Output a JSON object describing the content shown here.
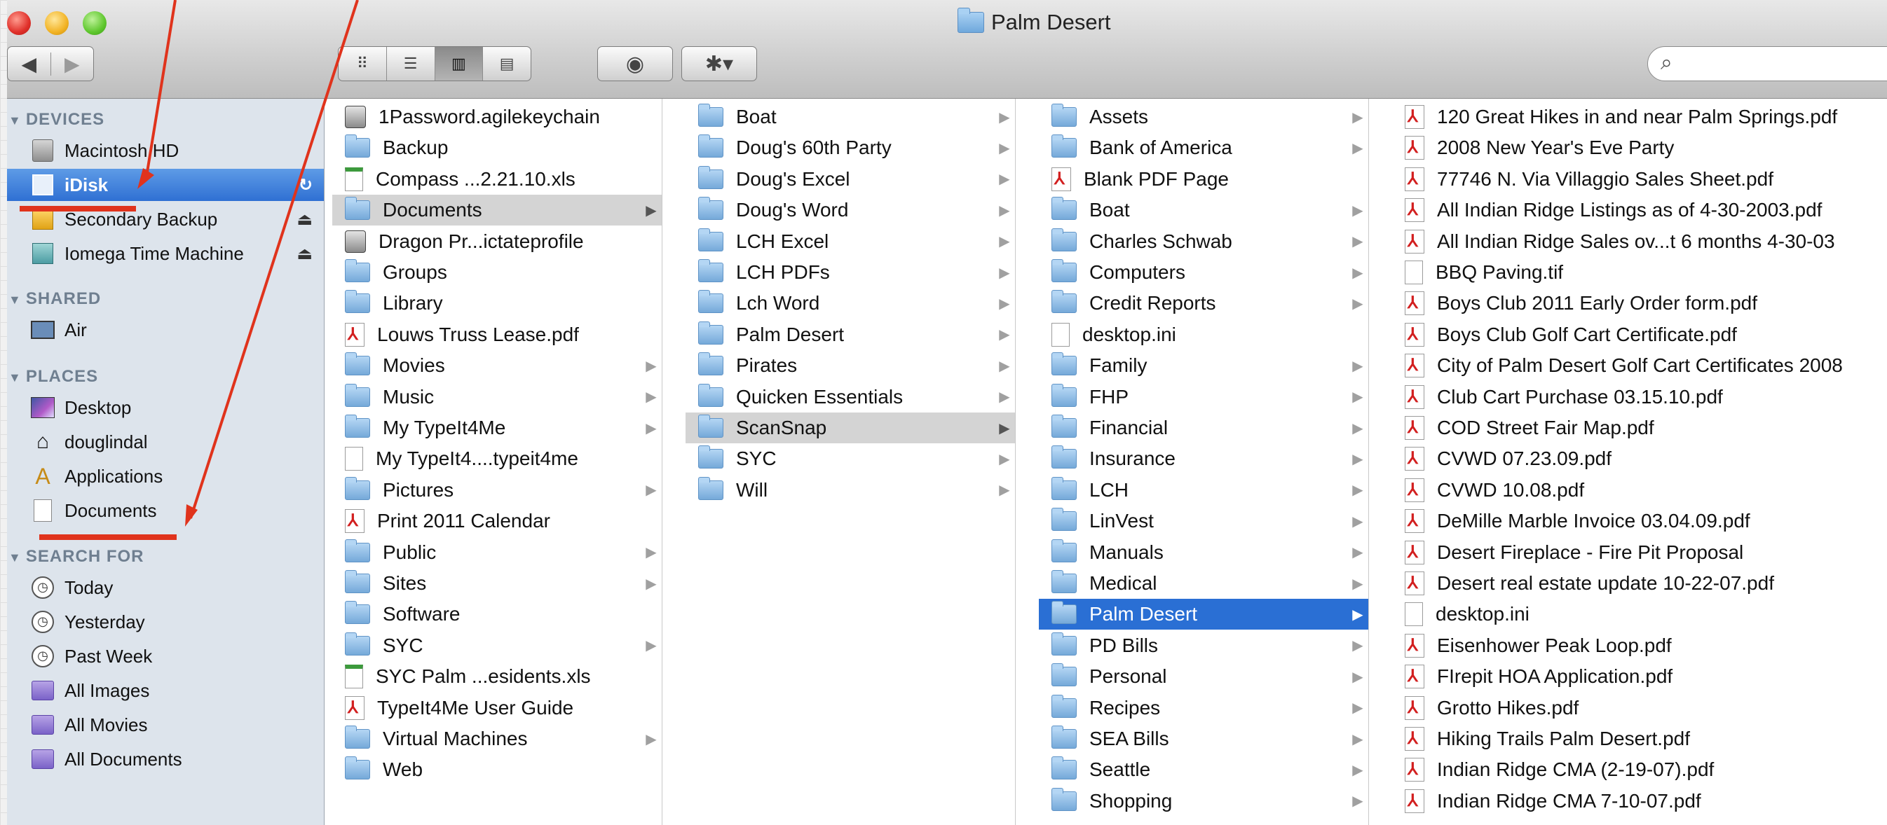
{
  "window": {
    "title": "Palm Desert"
  },
  "toolbar": {
    "back_icon": "◀",
    "forward_icon": "▶",
    "view_icons": [
      "icon-view-icon",
      "list-view-icon",
      "column-view-icon",
      "coverflow-view-icon"
    ],
    "view_glyphs": [
      "⠿",
      "☰",
      "▥",
      "▤"
    ],
    "quicklook_glyph": "◉",
    "action_glyph": "✱▾",
    "search_glyph": "⌕",
    "search_value": ""
  },
  "sidebar": {
    "devices_header": "DEVICES",
    "devices": [
      {
        "label": "Macintosh HD",
        "icon": "hard-disk-icon"
      },
      {
        "label": "iDisk",
        "icon": "idisk-icon",
        "selected": true,
        "badge": "↻"
      },
      {
        "label": "Secondary Backup",
        "icon": "external-disk-icon",
        "eject": "⏏"
      },
      {
        "label": "Iomega Time Machine",
        "icon": "time-machine-disk-icon",
        "eject": "⏏"
      }
    ],
    "shared_header": "SHARED",
    "shared": [
      {
        "label": "Air",
        "icon": "monitor-icon"
      }
    ],
    "places_header": "PLACES",
    "places": [
      {
        "label": "Desktop",
        "icon": "desktop-icon"
      },
      {
        "label": "douglindal",
        "icon": "home-icon"
      },
      {
        "label": "Applications",
        "icon": "applications-icon"
      },
      {
        "label": "Documents",
        "icon": "documents-icon"
      }
    ],
    "search_header": "SEARCH FOR",
    "search_for": [
      {
        "label": "Today",
        "icon": "clock-icon"
      },
      {
        "label": "Yesterday",
        "icon": "clock-icon"
      },
      {
        "label": "Past Week",
        "icon": "clock-icon"
      },
      {
        "label": "All Images",
        "icon": "smart-folder-icon"
      },
      {
        "label": "All Movies",
        "icon": "smart-folder-icon"
      },
      {
        "label": "All Documents",
        "icon": "smart-folder-icon"
      }
    ]
  },
  "columns": [
    {
      "items": [
        {
          "label": "1Password.agilekeychain",
          "type": "app"
        },
        {
          "label": "Backup",
          "type": "folder"
        },
        {
          "label": "Compass ...2.21.10.xls",
          "type": "xls"
        },
        {
          "label": "Documents",
          "type": "folder",
          "arrow": true,
          "selected": "gray"
        },
        {
          "label": "Dragon Pr...ictateprofile",
          "type": "app"
        },
        {
          "label": "Groups",
          "type": "folder"
        },
        {
          "label": "Library",
          "type": "folder"
        },
        {
          "label": "Louws Truss Lease.pdf",
          "type": "pdf"
        },
        {
          "label": "Movies",
          "type": "folder",
          "arrow": true
        },
        {
          "label": "Music",
          "type": "folder",
          "arrow": true
        },
        {
          "label": "My TypeIt4Me",
          "type": "folder",
          "arrow": true
        },
        {
          "label": "My TypeIt4....typeit4me",
          "type": "doc"
        },
        {
          "label": "Pictures",
          "type": "folder",
          "arrow": true
        },
        {
          "label": "Print 2011 Calendar",
          "type": "pdf"
        },
        {
          "label": "Public",
          "type": "folder",
          "arrow": true
        },
        {
          "label": "Sites",
          "type": "folder",
          "arrow": true
        },
        {
          "label": "Software",
          "type": "folder"
        },
        {
          "label": "SYC",
          "type": "folder",
          "arrow": true
        },
        {
          "label": "SYC Palm ...esidents.xls",
          "type": "xls"
        },
        {
          "label": "TypeIt4Me User Guide",
          "type": "pdf"
        },
        {
          "label": "Virtual Machines",
          "type": "folder",
          "arrow": true
        },
        {
          "label": "Web",
          "type": "folder"
        }
      ]
    },
    {
      "items": [
        {
          "label": "Boat",
          "type": "folder",
          "arrow": true
        },
        {
          "label": "Doug's 60th Party",
          "type": "folder",
          "arrow": true
        },
        {
          "label": "Doug's Excel",
          "type": "folder",
          "arrow": true
        },
        {
          "label": "Doug's Word",
          "type": "folder",
          "arrow": true
        },
        {
          "label": "LCH Excel",
          "type": "folder",
          "arrow": true
        },
        {
          "label": "LCH PDFs",
          "type": "folder",
          "arrow": true
        },
        {
          "label": "Lch Word",
          "type": "folder",
          "arrow": true
        },
        {
          "label": "Palm Desert",
          "type": "folder",
          "arrow": true
        },
        {
          "label": "Pirates",
          "type": "folder",
          "arrow": true
        },
        {
          "label": "Quicken Essentials",
          "type": "folder",
          "arrow": true
        },
        {
          "label": "ScanSnap",
          "type": "folder",
          "arrow": true,
          "selected": "gray"
        },
        {
          "label": "SYC",
          "type": "folder",
          "arrow": true
        },
        {
          "label": "Will",
          "type": "folder",
          "arrow": true
        }
      ]
    },
    {
      "items": [
        {
          "label": "Assets",
          "type": "folder",
          "arrow": true
        },
        {
          "label": "Bank of America",
          "type": "folder",
          "arrow": true
        },
        {
          "label": "Blank PDF Page",
          "type": "pdf"
        },
        {
          "label": "Boat",
          "type": "folder",
          "arrow": true
        },
        {
          "label": "Charles Schwab",
          "type": "folder",
          "arrow": true
        },
        {
          "label": "Computers",
          "type": "folder",
          "arrow": true
        },
        {
          "label": "Credit Reports",
          "type": "folder",
          "arrow": true
        },
        {
          "label": "desktop.ini",
          "type": "doc"
        },
        {
          "label": "Family",
          "type": "folder",
          "arrow": true
        },
        {
          "label": "FHP",
          "type": "folder",
          "arrow": true
        },
        {
          "label": "Financial",
          "type": "folder",
          "arrow": true
        },
        {
          "label": "Insurance",
          "type": "folder",
          "arrow": true
        },
        {
          "label": "LCH",
          "type": "folder",
          "arrow": true
        },
        {
          "label": "LinVest",
          "type": "folder",
          "arrow": true
        },
        {
          "label": "Manuals",
          "type": "folder",
          "arrow": true
        },
        {
          "label": "Medical",
          "type": "folder",
          "arrow": true
        },
        {
          "label": "Palm Desert",
          "type": "folder",
          "arrow": true,
          "selected": "blue"
        },
        {
          "label": "PD Bills",
          "type": "folder",
          "arrow": true
        },
        {
          "label": "Personal",
          "type": "folder",
          "arrow": true
        },
        {
          "label": "Recipes",
          "type": "folder",
          "arrow": true
        },
        {
          "label": "SEA Bills",
          "type": "folder",
          "arrow": true
        },
        {
          "label": "Seattle",
          "type": "folder",
          "arrow": true
        },
        {
          "label": "Shopping",
          "type": "folder",
          "arrow": true
        }
      ]
    },
    {
      "items": [
        {
          "label": "120 Great Hikes in and near Palm Springs.pdf",
          "type": "pdf"
        },
        {
          "label": "2008 New Year's Eve Party",
          "type": "pdf"
        },
        {
          "label": "77746 N. Via Villaggio Sales Sheet.pdf",
          "type": "pdf"
        },
        {
          "label": "All Indian Ridge Listings as of 4-30-2003.pdf",
          "type": "pdf"
        },
        {
          "label": "All Indian Ridge Sales ov...t 6 months 4-30-03",
          "type": "pdf"
        },
        {
          "label": "BBQ Paving.tif",
          "type": "doc"
        },
        {
          "label": "Boys Club 2011 Early Order form.pdf",
          "type": "pdf"
        },
        {
          "label": "Boys Club Golf Cart Certificate.pdf",
          "type": "pdf"
        },
        {
          "label": "City of Palm Desert Golf Cart Certificates 2008",
          "type": "pdf"
        },
        {
          "label": "Club Cart Purchase 03.15.10.pdf",
          "type": "pdf"
        },
        {
          "label": "COD Street Fair Map.pdf",
          "type": "pdf"
        },
        {
          "label": "CVWD 07.23.09.pdf",
          "type": "pdf"
        },
        {
          "label": "CVWD 10.08.pdf",
          "type": "pdf"
        },
        {
          "label": "DeMille Marble Invoice 03.04.09.pdf",
          "type": "pdf"
        },
        {
          "label": "Desert Fireplace - Fire Pit Proposal",
          "type": "pdf"
        },
        {
          "label": "Desert real estate update 10-22-07.pdf",
          "type": "pdf"
        },
        {
          "label": "desktop.ini",
          "type": "doc"
        },
        {
          "label": "Eisenhower Peak Loop.pdf",
          "type": "pdf"
        },
        {
          "label": "FIrepit HOA Application.pdf",
          "type": "pdf"
        },
        {
          "label": "Grotto Hikes.pdf",
          "type": "pdf"
        },
        {
          "label": "Hiking Trails Palm Desert.pdf",
          "type": "pdf"
        },
        {
          "label": "Indian Ridge CMA (2-19-07).pdf",
          "type": "pdf"
        },
        {
          "label": "Indian Ridge CMA 7-10-07.pdf",
          "type": "pdf"
        }
      ]
    }
  ]
}
